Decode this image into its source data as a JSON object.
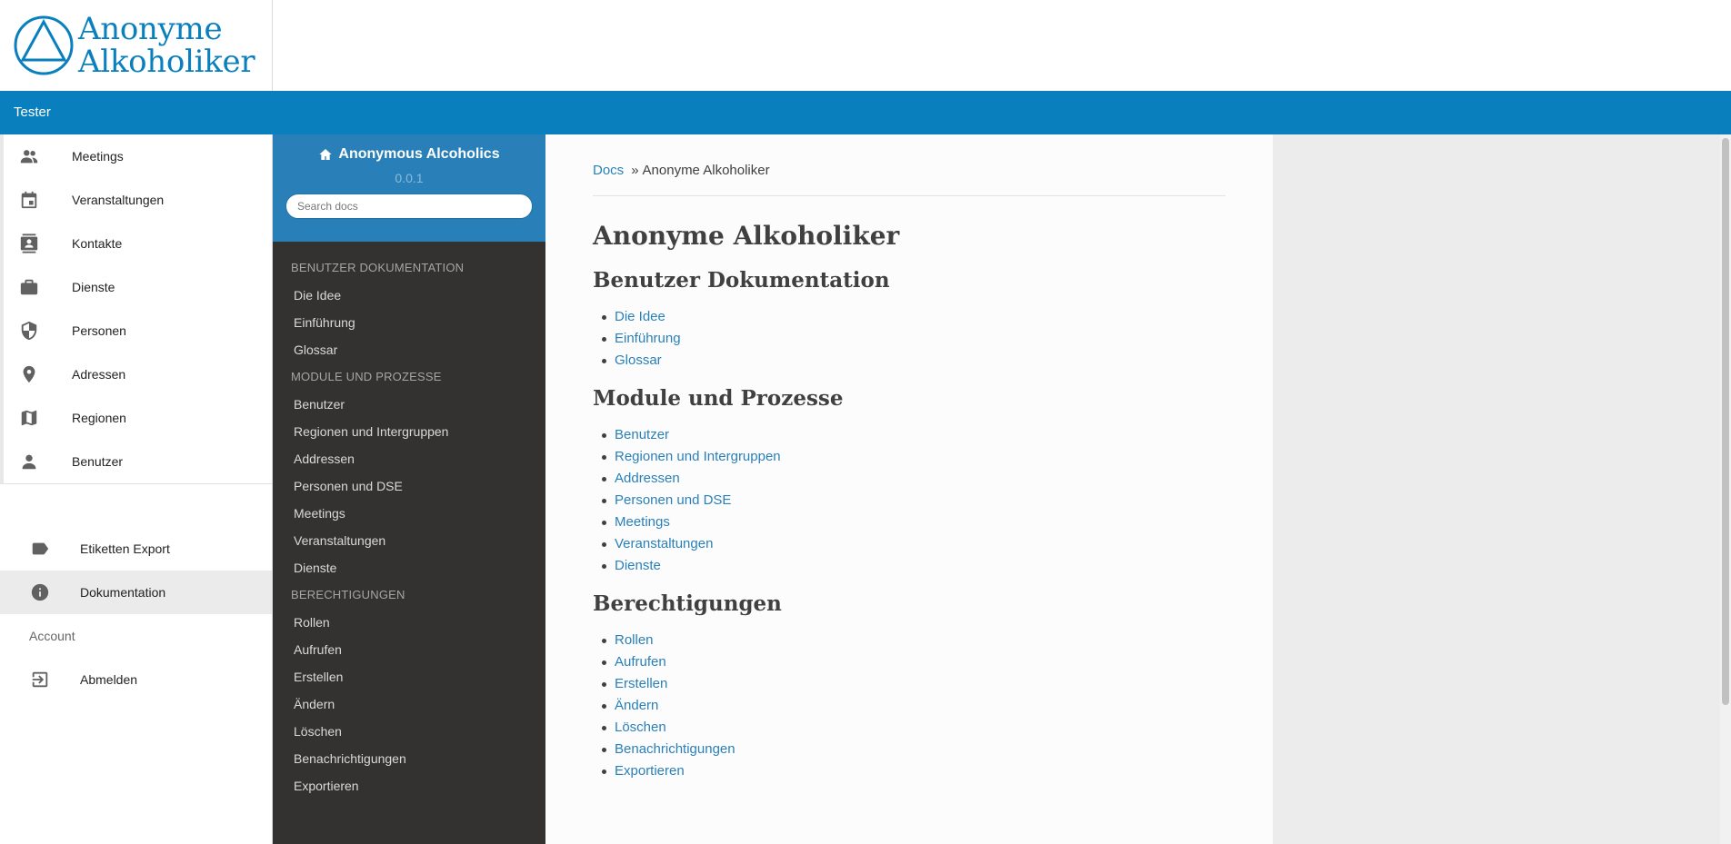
{
  "app": {
    "logo_line1": "Anonyme",
    "logo_line2": "Alkoholiker",
    "user_name": "Tester",
    "brand_color": "#0a7fbd"
  },
  "main_nav": [
    {
      "label": "Meetings",
      "icon": "people-icon"
    },
    {
      "label": "Veranstaltungen",
      "icon": "calendar-icon"
    },
    {
      "label": "Kontakte",
      "icon": "contacts-icon"
    },
    {
      "label": "Dienste",
      "icon": "briefcase-icon"
    },
    {
      "label": "Personen",
      "icon": "shield-icon"
    },
    {
      "label": "Adressen",
      "icon": "location-pin-icon"
    },
    {
      "label": "Regionen",
      "icon": "map-icon"
    },
    {
      "label": "Benutzer",
      "icon": "person-icon"
    }
  ],
  "secondary_nav": {
    "etiketten_export": "Etiketten Export",
    "dokumentation": "Dokumentation",
    "account_heading": "Account",
    "abmelden": "Abmelden"
  },
  "docs_nav": {
    "project": "Anonymous Alcoholics",
    "version": "0.0.1",
    "search_placeholder": "Search docs",
    "sections": [
      {
        "caption": "BENUTZER DOKUMENTATION",
        "links": [
          "Die Idee",
          "Einführung",
          "Glossar"
        ]
      },
      {
        "caption": "MODULE UND PROZESSE",
        "links": [
          "Benutzer",
          "Regionen und Intergruppen",
          "Addressen",
          "Personen und DSE",
          "Meetings",
          "Veranstaltungen",
          "Dienste"
        ]
      },
      {
        "caption": "BERECHTIGUNGEN",
        "links": [
          "Rollen",
          "Aufrufen",
          "Erstellen",
          "Ändern",
          "Löschen",
          "Benachrichtigungen",
          "Exportieren"
        ]
      }
    ]
  },
  "content": {
    "breadcrumb_root": "Docs",
    "breadcrumb_sep": "»",
    "breadcrumb_current": "Anonyme Alkoholiker",
    "title": "Anonyme Alkoholiker",
    "sections": [
      {
        "heading": "Benutzer Dokumentation",
        "links": [
          "Die Idee",
          "Einführung",
          "Glossar"
        ]
      },
      {
        "heading": "Module und Prozesse",
        "links": [
          "Benutzer",
          "Regionen und Intergruppen",
          "Addressen",
          "Personen und DSE",
          "Meetings",
          "Veranstaltungen",
          "Dienste"
        ]
      },
      {
        "heading": "Berechtigungen",
        "links": [
          "Rollen",
          "Aufrufen",
          "Erstellen",
          "Ändern",
          "Löschen",
          "Benachrichtigungen",
          "Exportieren"
        ]
      }
    ]
  }
}
